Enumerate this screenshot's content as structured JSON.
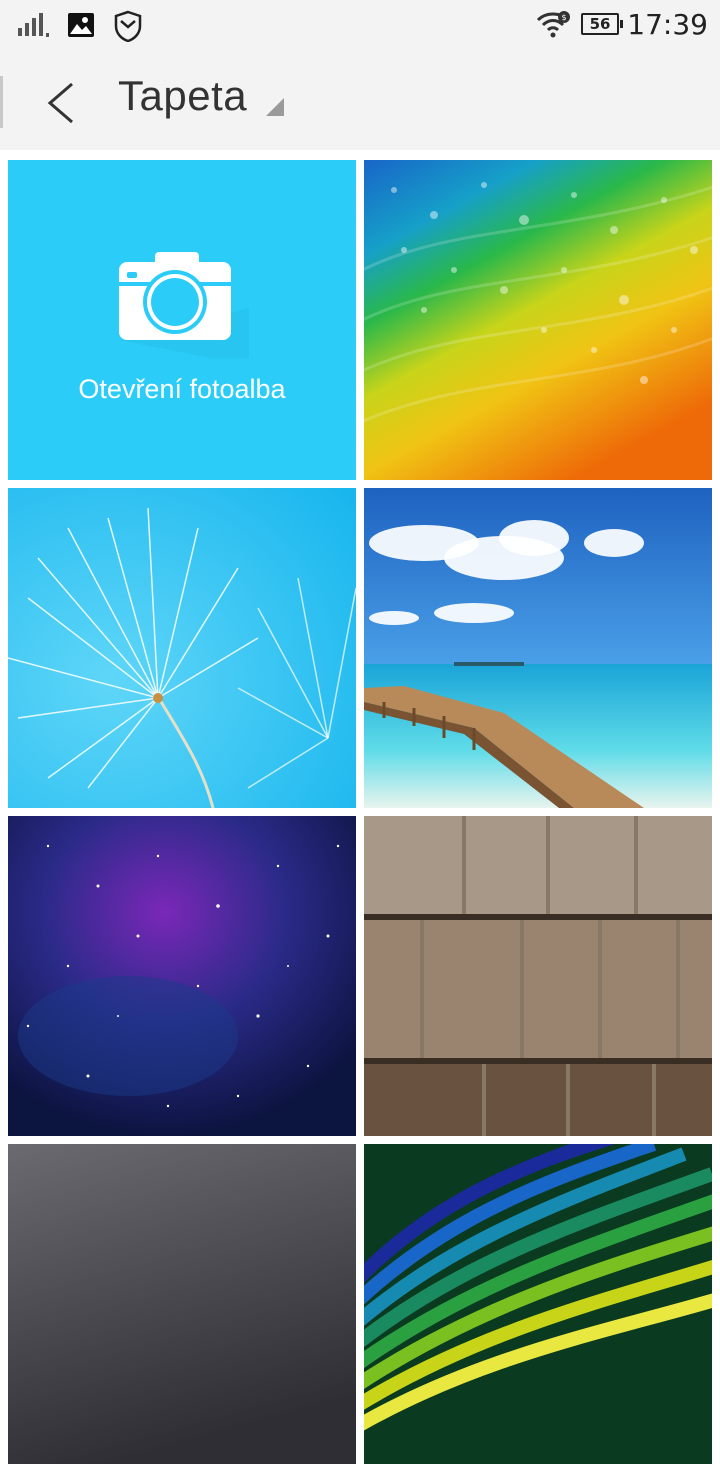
{
  "status_bar": {
    "icons": [
      "signal-icon",
      "image-notification-icon",
      "shield-icon",
      "wifi-icon"
    ],
    "battery_level": "56",
    "time": "17:39"
  },
  "header": {
    "title": "Tapeta",
    "back_icon": "chevron-left-icon",
    "dropdown_icon": "triangle-dropdown-icon"
  },
  "grid": {
    "album_tile": {
      "label": "Otevření fotoalba",
      "icon": "camera-icon",
      "color": "#2bcdf8"
    },
    "wallpapers": [
      {
        "name": "rainbow-droplets"
      },
      {
        "name": "dandelion-blue"
      },
      {
        "name": "beach-pier"
      },
      {
        "name": "starry-galaxy"
      },
      {
        "name": "wood-shingles"
      },
      {
        "name": "gray-texture"
      },
      {
        "name": "rainbow-layers"
      }
    ]
  }
}
